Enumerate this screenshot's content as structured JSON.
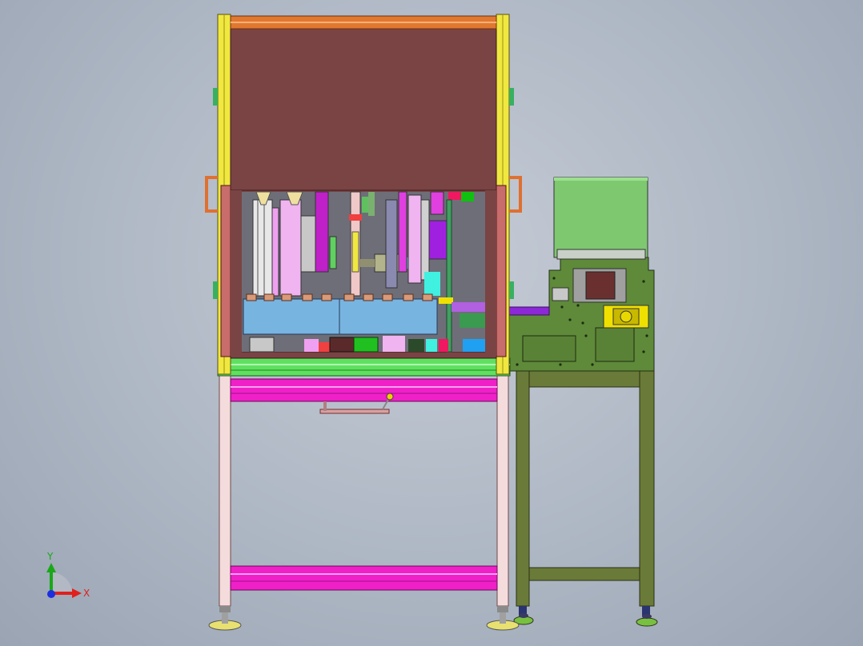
{
  "viewport": {
    "background_top": "#c6ccd6",
    "background_bottom": "#9aa4b3"
  },
  "triad": {
    "x_label": "X",
    "y_label": "Y",
    "x_color": "#e0201c",
    "y_color": "#18a818",
    "z_color": "#1c2ee0"
  },
  "colors": {
    "frame_yellow": "#f0e840",
    "enclosure_brown": "#7a4444",
    "top_bar_orange": "#e07830",
    "beam_magenta": "#f020c8",
    "beam_green": "#60e060",
    "leg_pink": "#f4dcdc",
    "side_frame_olive": "#6a7a38",
    "side_plate_green": "#5e8a3a",
    "hopper_green": "#7ec870",
    "panel_blue": "#78b4e0"
  }
}
